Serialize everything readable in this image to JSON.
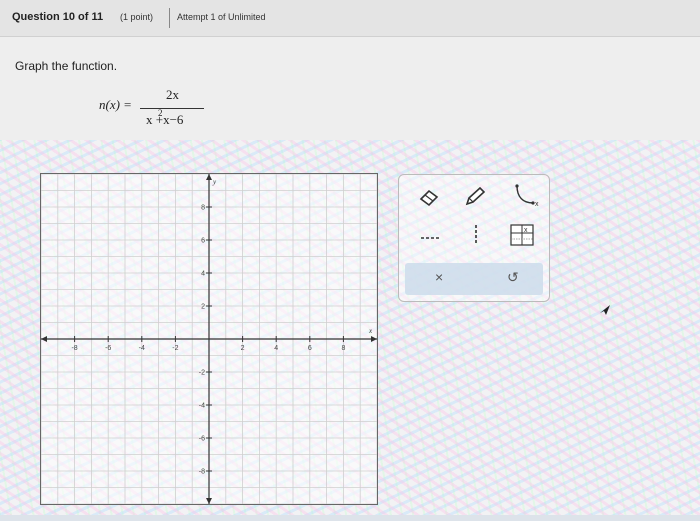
{
  "header": {
    "question": "Question 10 of 11",
    "points": "(1 point)",
    "attempt": "Attempt 1 of Unlimited"
  },
  "problem": {
    "prompt": "Graph the function.",
    "function_label": "n(x) =",
    "numerator": "2x",
    "denominator": "x +x−6",
    "denominator_exponent": "2"
  },
  "graph": {
    "x_axis_label": "x",
    "y_axis_label": "y",
    "x_ticks": [
      -8,
      -6,
      -4,
      -2,
      2,
      4,
      6,
      8
    ],
    "y_ticks": [
      8,
      6,
      4,
      2,
      -2,
      -4,
      -6,
      -8
    ],
    "x_range": [
      -10,
      10
    ],
    "y_range": [
      -10,
      10
    ]
  },
  "toolbox": {
    "tools": [
      "eraser-icon",
      "pencil-icon",
      "curve-icon",
      "dashed-line-icon",
      "vertical-dashed-line-icon",
      "table-icon"
    ],
    "actions": [
      "clear-icon",
      "undo-icon"
    ],
    "clear_glyph": "×",
    "undo_glyph": "↺"
  }
}
